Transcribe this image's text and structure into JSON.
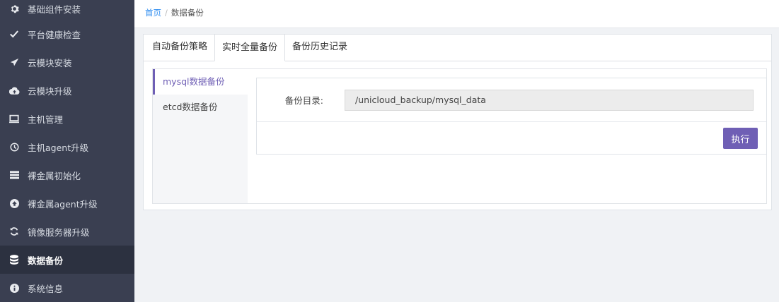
{
  "sidebar": {
    "items": [
      {
        "label": "基础组件安装",
        "icon": "gear-icon"
      },
      {
        "label": "平台健康检查",
        "icon": "check-icon"
      },
      {
        "label": "云模块安装",
        "icon": "send-icon"
      },
      {
        "label": "云模块升级",
        "icon": "cloud-upload-icon"
      },
      {
        "label": "主机管理",
        "icon": "monitor-icon"
      },
      {
        "label": "主机agent升级",
        "icon": "clock-icon"
      },
      {
        "label": "裸金属初始化",
        "icon": "server-icon"
      },
      {
        "label": "裸金属agent升级",
        "icon": "arrow-up-circle-icon"
      },
      {
        "label": "镜像服务器升级",
        "icon": "refresh-icon"
      },
      {
        "label": "数据备份",
        "icon": "database-icon"
      },
      {
        "label": "系统信息",
        "icon": "info-icon"
      }
    ],
    "active_index": 9
  },
  "breadcrumb": {
    "home": "首页",
    "separator": "/",
    "current": "数据备份"
  },
  "tabs": [
    {
      "label": "自动备份策略"
    },
    {
      "label": "实时全量备份"
    },
    {
      "label": "备份历史记录"
    }
  ],
  "active_tab": 1,
  "subnav": [
    {
      "label": "mysql数据备份"
    },
    {
      "label": "etcd数据备份"
    }
  ],
  "form": {
    "backup_dir_label": "备份目录:",
    "backup_dir_value": "/unicloud_backup/mysql_data",
    "execute_label": "执行"
  },
  "colors": {
    "accent": "#6f5fb5",
    "sidebar_bg": "#3a3f51",
    "sidebar_active_bg": "#2c3140",
    "link": "#2d8cf0"
  }
}
